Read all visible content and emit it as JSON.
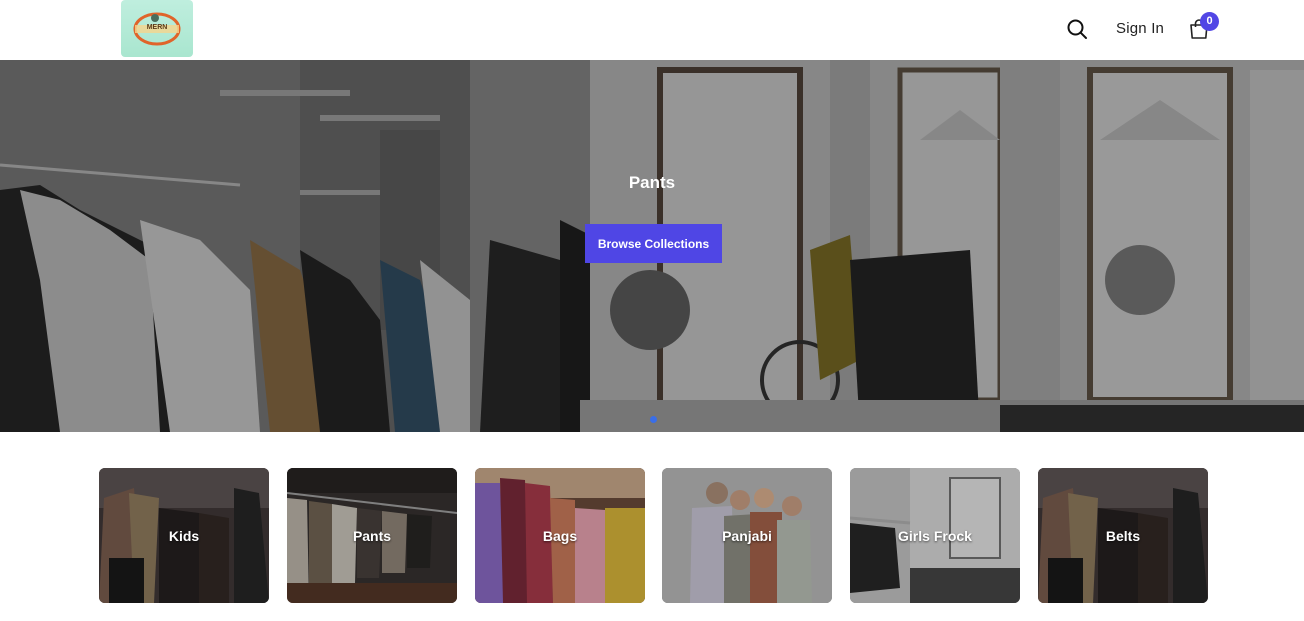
{
  "header": {
    "logo_alt": "logo",
    "logo_text": "MERN",
    "search_icon": "search-icon",
    "signin_label": "Sign In",
    "cart_icon": "shopping-bag-icon",
    "cart_count": "0"
  },
  "hero": {
    "title": "Pants",
    "button_label": "Browse Collections",
    "slide_indicator_active": 1
  },
  "categories": [
    {
      "label": "Kids"
    },
    {
      "label": "Pants"
    },
    {
      "label": "Bags"
    },
    {
      "label": "Panjabi"
    },
    {
      "label": "Girls Frock"
    },
    {
      "label": "Belts"
    }
  ],
  "colors": {
    "accent": "#4f46e5",
    "badge": "#5146e5",
    "logo_bg": "#bfeede"
  }
}
